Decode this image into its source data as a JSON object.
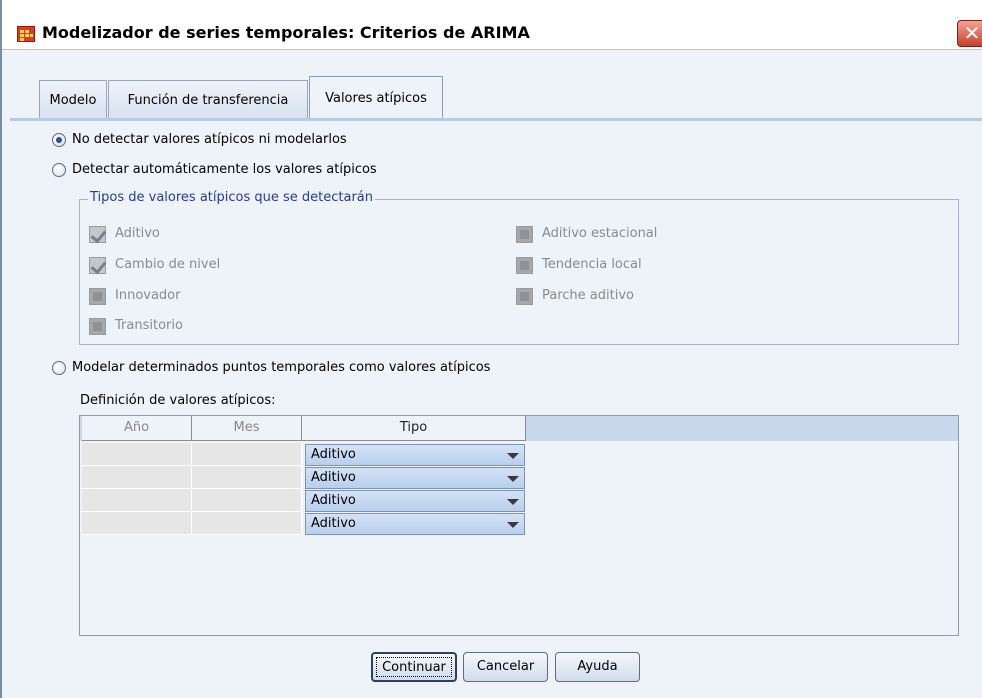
{
  "window": {
    "title": "Modelizador de series temporales: Criterios de ARIMA",
    "close_glyph": "✕",
    "icon": "spreadsheet-app-icon"
  },
  "tabs": [
    {
      "label": "Modelo",
      "active": false
    },
    {
      "label": "Función de transferencia",
      "active": false
    },
    {
      "label": "Valores atípicos",
      "active": true
    }
  ],
  "options": {
    "no_detect": {
      "label": "No detectar valores atípicos ni modelarlos",
      "checked": true
    },
    "auto_detect": {
      "label": "Detectar automáticamente los valores atípicos",
      "checked": false
    },
    "model_points": {
      "label": "Modelar determinados puntos temporales como valores atípicos",
      "checked": false
    }
  },
  "types_group": {
    "legend": "Tipos de valores atípicos que se detectarán",
    "left": [
      {
        "label": "Aditivo",
        "checked": true,
        "enabled": false
      },
      {
        "label": "Cambio de nivel",
        "checked": true,
        "enabled": false
      },
      {
        "label": "Innovador",
        "checked": false,
        "enabled": false
      },
      {
        "label": "Transitorio",
        "checked": false,
        "enabled": false
      }
    ],
    "right": [
      {
        "label": "Aditivo estacional",
        "checked": false,
        "enabled": false
      },
      {
        "label": "Tendencia local",
        "checked": false,
        "enabled": false
      },
      {
        "label": "Parche aditivo",
        "checked": false,
        "enabled": false
      }
    ]
  },
  "definition": {
    "label": "Definición de valores atípicos:",
    "columns": [
      "Año",
      "Mes",
      "Tipo"
    ],
    "rows": [
      {
        "year": "",
        "month": "",
        "type": "Aditivo"
      },
      {
        "year": "",
        "month": "",
        "type": "Aditivo"
      },
      {
        "year": "",
        "month": "",
        "type": "Aditivo"
      },
      {
        "year": "",
        "month": "",
        "type": "Aditivo"
      }
    ]
  },
  "buttons": {
    "continue": "Continuar",
    "cancel": "Cancelar",
    "help": "Ayuda"
  },
  "colors": {
    "dialog_bg": "#eef2f9",
    "legend_text": "#2a3b8f",
    "select_bg": "#c6d8f2"
  }
}
